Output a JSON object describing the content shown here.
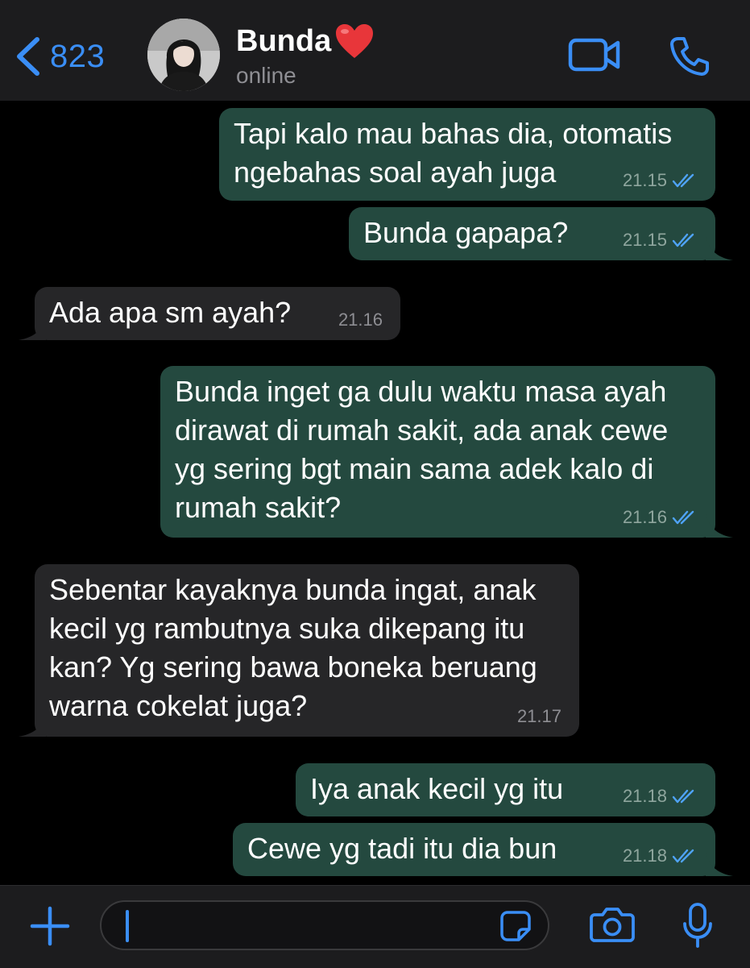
{
  "header": {
    "back_count": "823",
    "contact_name": "Bunda",
    "contact_status": "online"
  },
  "messages": [
    {
      "direction": "outgoing",
      "text": "Tapi kalo mau bahas dia, otomatis\nngebahas soal ayah juga",
      "time": "21.15",
      "read": true
    },
    {
      "direction": "outgoing",
      "text": "Bunda gapapa?",
      "time": "21.15",
      "read": true
    },
    {
      "direction": "incoming",
      "text": "Ada apa sm ayah?",
      "time": "21.16"
    },
    {
      "direction": "outgoing",
      "text": "Bunda inget ga dulu waktu masa ayah\ndirawat di rumah sakit, ada anak cewe\nyg sering bgt main sama adek kalo di\nrumah sakit?",
      "time": "21.16",
      "read": true
    },
    {
      "direction": "incoming",
      "text": "Sebentar kayaknya bunda ingat, anak\nkecil yg rambutnya suka dikepang itu\nkan? Yg sering bawa boneka beruang\nwarna cokelat juga?",
      "time": "21.17"
    },
    {
      "direction": "outgoing",
      "text": "Iya anak kecil yg itu",
      "time": "21.18",
      "read": true
    },
    {
      "direction": "outgoing",
      "text": "Cewe yg tadi itu dia bun",
      "time": "21.18",
      "read": true
    }
  ],
  "composer": {
    "value": ""
  },
  "icons": {
    "back": "chevron-left-icon",
    "heart": "red-heart-emoji",
    "video": "video-camera-icon",
    "call": "phone-icon",
    "add": "plus-icon",
    "sticker": "sticker-icon",
    "camera": "camera-icon",
    "mic": "microphone-icon",
    "read_receipt": "double-check-icon"
  },
  "colors": {
    "accent": "#3a8ef6",
    "outgoing_bubble": "#24493f",
    "incoming_bubble": "#262628",
    "header_bg": "#1c1c1e",
    "chat_bg": "#000000",
    "read_ticks": "#4fa3f7",
    "heart": "#e8363a"
  }
}
